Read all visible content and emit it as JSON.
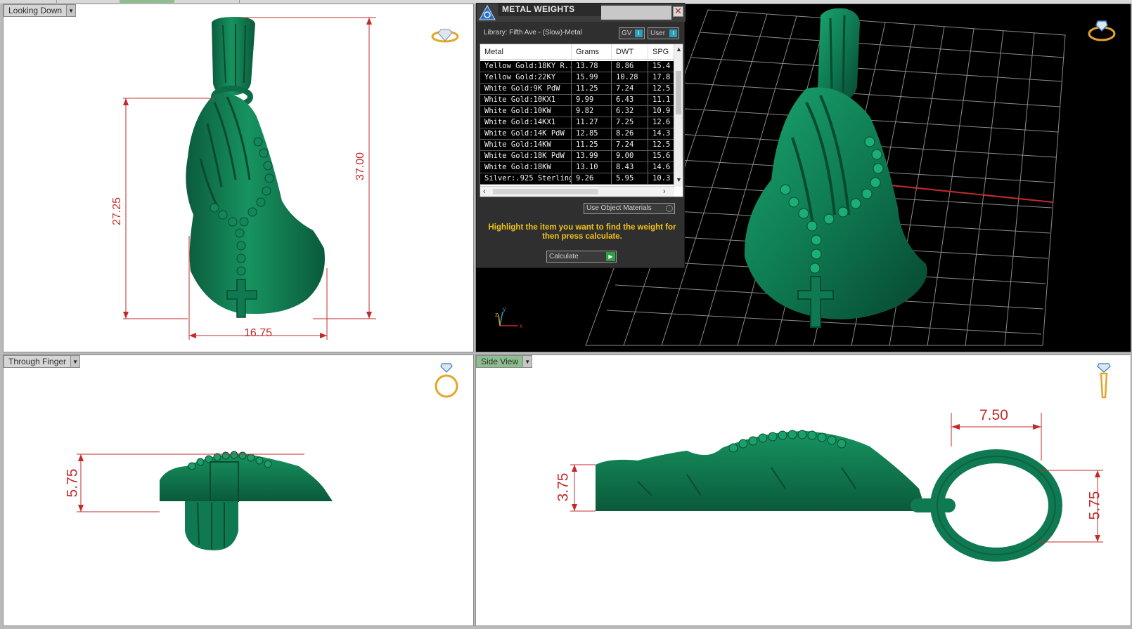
{
  "viewports": {
    "top_left": {
      "label": "Looking Down",
      "dims": {
        "height_total": "37.00",
        "height_body": "27.25",
        "width": "16.75"
      }
    },
    "top_right": {
      "axis": {
        "z": "z",
        "y": "y",
        "x": "x"
      }
    },
    "bottom_left": {
      "label": "Through Finger",
      "dims": {
        "thickness": "5.75"
      }
    },
    "bottom_right": {
      "label": "Side View",
      "dims": {
        "bail_width": "7.50",
        "body_thickness": "3.75",
        "bail_height": "5.75"
      }
    }
  },
  "metal_weights": {
    "title": "METAL WEIGHTS",
    "library": "Library: Fifth Ave - (Slow)-Metal",
    "toggle_gv": "GV",
    "toggle_user": "User",
    "columns": [
      "Metal",
      "Grams",
      "DWT",
      "SPG"
    ],
    "rows": [
      {
        "metal": "Yellow Gold:18KY R...",
        "grams": "13.78",
        "dwt": "8.86",
        "spg": "15.4"
      },
      {
        "metal": "Yellow Gold:22KY",
        "grams": "15.99",
        "dwt": "10.28",
        "spg": "17.8"
      },
      {
        "metal": "White Gold:9K PdW",
        "grams": "11.25",
        "dwt": "7.24",
        "spg": "12.5"
      },
      {
        "metal": "White Gold:10KX1",
        "grams": "9.99",
        "dwt": "6.43",
        "spg": "11.1"
      },
      {
        "metal": "White Gold:10KW",
        "grams": "9.82",
        "dwt": "6.32",
        "spg": "10.9"
      },
      {
        "metal": "White Gold:14KX1",
        "grams": "11.27",
        "dwt": "7.25",
        "spg": "12.6"
      },
      {
        "metal": "White Gold:14K PdW",
        "grams": "12.85",
        "dwt": "8.26",
        "spg": "14.3"
      },
      {
        "metal": "White Gold:14KW",
        "grams": "11.25",
        "dwt": "7.24",
        "spg": "12.5"
      },
      {
        "metal": "White Gold:18K PdW",
        "grams": "13.99",
        "dwt": "9.00",
        "spg": "15.6"
      },
      {
        "metal": "White Gold:18KW",
        "grams": "13.10",
        "dwt": "8.43",
        "spg": "14.6"
      },
      {
        "metal": "Silver:.925 Sterling",
        "grams": "9.26",
        "dwt": "5.95",
        "spg": "10.3"
      }
    ],
    "use_object_materials": "Use Object Materials",
    "hint": "Highlight the item you want to find the weight for then press calculate.",
    "calculate": "Calculate"
  },
  "colors": {
    "model_green": "#0f7a52",
    "dimension_red": "#c32b2b",
    "active_tab": "#8dbf8e",
    "hint_yellow": "#f2c21a"
  },
  "icons": [
    "diamond-ring-icon",
    "ring-orbit-icon",
    "ring-front-icon",
    "ring-side-icon",
    "close-icon",
    "axis-gizmo-icon"
  ]
}
